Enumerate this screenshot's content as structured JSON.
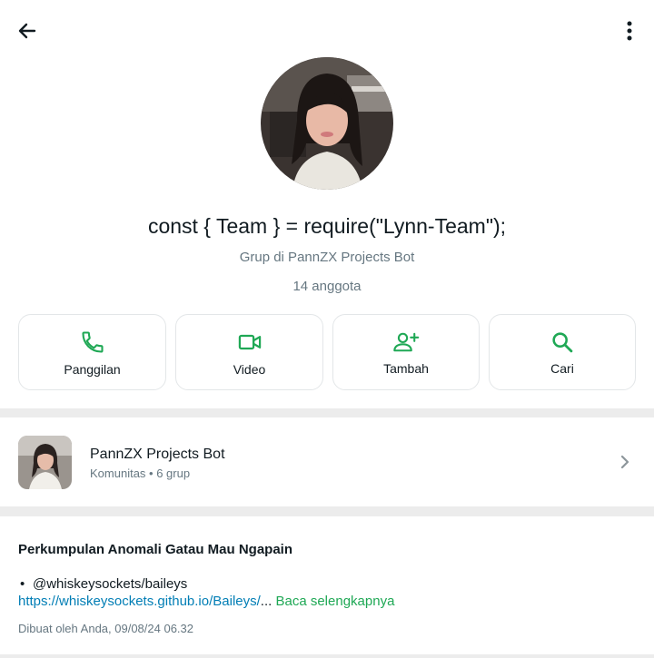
{
  "header": {
    "back_icon": "arrow-left-icon",
    "menu_icon": "more-vertical-icon"
  },
  "group": {
    "name": "const { Team } = require(\"Lynn-Team\");",
    "subtitle": "Grup di PannZX Projects Bot",
    "members": "14 anggota"
  },
  "actions": [
    {
      "label": "Panggilan",
      "icon": "phone-icon"
    },
    {
      "label": "Video",
      "icon": "video-icon"
    },
    {
      "label": "Tambah",
      "icon": "add-person-icon"
    },
    {
      "label": "Cari",
      "icon": "search-icon"
    }
  ],
  "community": {
    "name": "PannZX Projects Bot",
    "meta": "Komunitas • 6 grup"
  },
  "description": {
    "title": "Perkumpulan Anomali Gatau Mau Ngapain",
    "bullet": "@whiskeysockets/baileys",
    "link": "https://whiskeysockets.github.io/Baileys/",
    "ellipsis": "...",
    "read_more": "Baca selengkapnya",
    "created": "Dibuat oleh Anda, 09/08/24 06.32"
  },
  "colors": {
    "accent": "#1fa855",
    "link": "#027eb5",
    "secondary_text": "#667781",
    "divider_bg": "#ececec"
  }
}
